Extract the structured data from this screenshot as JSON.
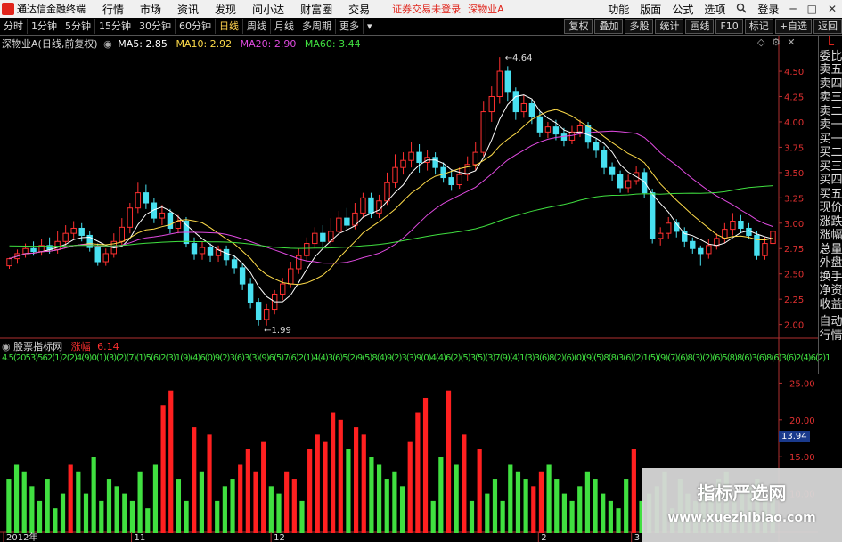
{
  "menubar": {
    "app_name": "通达信金融终端",
    "items": [
      "行情",
      "市场",
      "资讯",
      "发现",
      "问小达",
      "财富圈",
      "交易"
    ],
    "status": "证券交易未登录",
    "stock": "深物业A",
    "right_items": [
      "功能",
      "版面",
      "公式",
      "选项"
    ],
    "search_icon": "search-icon",
    "login": "登录",
    "window_buttons": [
      "─",
      "□",
      "✕"
    ]
  },
  "toolbar": {
    "periods": [
      "分时",
      "1分钟",
      "5分钟",
      "15分钟",
      "30分钟",
      "60分钟",
      "日线",
      "周线",
      "月线",
      "多周期",
      "更多"
    ],
    "active_period": "日线",
    "right_buttons": [
      "复权",
      "叠加",
      "多股",
      "统计",
      "画线",
      "F10",
      "标记",
      "+自选",
      "返回"
    ]
  },
  "main_chart": {
    "stock_label": "深物业A(日线,前复权)",
    "ma5": "MA5: 2.85",
    "ma10": "MA10: 2.92",
    "ma20": "MA20: 2.90",
    "ma60": "MA60: 3.44",
    "high_label": "4.64",
    "low_label": "1.99",
    "colors": {
      "up": "#ff3030",
      "down": "#48e0f0",
      "ma5": "#ffffff",
      "ma10": "#ffdc4a",
      "ma20": "#e04ae0",
      "ma60": "#40e040"
    }
  },
  "right_panel": [
    "L",
    "委比",
    "卖五",
    "卖四",
    "卖三",
    "卖二",
    "卖一",
    "买一",
    "买二",
    "买三",
    "买四",
    "买五",
    "现价",
    "涨跌",
    "涨幅",
    "总量",
    "外盘",
    "换手",
    "净资",
    "收益",
    "自动",
    "行情"
  ],
  "indicator": {
    "name": "股票指标网",
    "param_label": "涨幅",
    "param_value": "6.14",
    "value_strip": "4.5(2053)562(1)2(2)4(9)0(1)(3)(2)(7)(1)5(6)2(3)1(9)(4)6(0)9(2)3(6)3(3)(9)6(5)7(6)2(1)4(4)3(6)5(2)9(5)8(4)9(2)3(3)9(0)4(4)6(2)(5)3(5)(3)7(9)(4)1(3)3(6)8(2)(6)(0)(9)(5)8(8)3(6)(2)1(5)(9)(7)(6)8(3)(2)(6)5(8)8(6)3(6)8(6)3(6)2(4)6(2)1"
  },
  "badge": "13.94",
  "watermark": {
    "title": "指标严选网",
    "url": "www.xuezhibiao.com"
  },
  "chart_data": [
    {
      "type": "candlestick",
      "title": "深物业A(日线,前复权)",
      "y_ticks": [
        "4.50",
        "4.25",
        "4.00",
        "3.75",
        "3.50",
        "3.25",
        "3.00",
        "2.75",
        "2.50",
        "2.25",
        "2.00"
      ],
      "ylim": [
        1.9,
        4.72
      ],
      "annotations": [
        {
          "text": "4.64",
          "value": 4.64
        },
        {
          "text": "1.99",
          "value": 1.99
        }
      ],
      "candles": [
        [
          2.58,
          2.65,
          2.55,
          2.66
        ],
        [
          2.65,
          2.7,
          2.6,
          2.74
        ],
        [
          2.7,
          2.75,
          2.66,
          2.8
        ],
        [
          2.75,
          2.72,
          2.68,
          2.82
        ],
        [
          2.72,
          2.78,
          2.68,
          2.84
        ],
        [
          2.78,
          2.74,
          2.7,
          2.86
        ],
        [
          2.74,
          2.82,
          2.7,
          2.92
        ],
        [
          2.82,
          2.9,
          2.78,
          2.98
        ],
        [
          2.9,
          2.95,
          2.85,
          3.02
        ],
        [
          2.95,
          2.88,
          2.82,
          3.0
        ],
        [
          2.88,
          2.76,
          2.72,
          2.92
        ],
        [
          2.76,
          2.62,
          2.58,
          2.8
        ],
        [
          2.62,
          2.7,
          2.58,
          2.75
        ],
        [
          2.7,
          2.82,
          2.66,
          2.9
        ],
        [
          2.82,
          2.96,
          2.78,
          3.05
        ],
        [
          2.96,
          3.15,
          2.9,
          3.2
        ],
        [
          3.15,
          3.3,
          3.1,
          3.4
        ],
        [
          3.3,
          3.2,
          3.14,
          3.38
        ],
        [
          3.2,
          3.05,
          3.0,
          3.25
        ],
        [
          3.05,
          3.1,
          2.98,
          3.18
        ],
        [
          3.1,
          2.95,
          2.9,
          3.14
        ],
        [
          2.95,
          3.02,
          2.9,
          3.08
        ],
        [
          3.02,
          2.8,
          2.76,
          3.06
        ],
        [
          2.8,
          2.7,
          2.64,
          2.86
        ],
        [
          2.7,
          2.76,
          2.64,
          2.82
        ],
        [
          2.76,
          2.68,
          2.62,
          2.8
        ],
        [
          2.68,
          2.74,
          2.62,
          2.78
        ],
        [
          2.74,
          2.64,
          2.58,
          2.78
        ],
        [
          2.64,
          2.56,
          2.5,
          2.68
        ],
        [
          2.56,
          2.4,
          2.34,
          2.6
        ],
        [
          2.4,
          2.22,
          2.16,
          2.46
        ],
        [
          2.22,
          2.05,
          1.99,
          2.26
        ],
        [
          2.05,
          2.15,
          1.99,
          2.2
        ],
        [
          2.15,
          2.3,
          2.1,
          2.34
        ],
        [
          2.3,
          2.4,
          2.24,
          2.46
        ],
        [
          2.4,
          2.55,
          2.36,
          2.62
        ],
        [
          2.55,
          2.68,
          2.5,
          2.75
        ],
        [
          2.68,
          2.8,
          2.62,
          2.86
        ],
        [
          2.8,
          2.9,
          2.75,
          2.96
        ],
        [
          2.9,
          2.82,
          2.74,
          2.98
        ],
        [
          2.82,
          2.92,
          2.78,
          3.05
        ],
        [
          2.92,
          3.05,
          2.88,
          3.12
        ],
        [
          3.05,
          2.98,
          2.92,
          3.15
        ],
        [
          2.98,
          3.1,
          2.94,
          3.2
        ],
        [
          3.1,
          3.25,
          3.05,
          3.3
        ],
        [
          3.25,
          3.1,
          3.05,
          3.3
        ],
        [
          3.1,
          3.22,
          3.05,
          3.28
        ],
        [
          3.22,
          3.4,
          3.18,
          3.5
        ],
        [
          3.4,
          3.55,
          3.35,
          3.68
        ],
        [
          3.55,
          3.62,
          3.48,
          3.7
        ],
        [
          3.62,
          3.7,
          3.55,
          3.8
        ],
        [
          3.7,
          3.6,
          3.5,
          3.78
        ],
        [
          3.6,
          3.65,
          3.52,
          3.72
        ],
        [
          3.65,
          3.55,
          3.48,
          3.7
        ],
        [
          3.55,
          3.45,
          3.4,
          3.6
        ],
        [
          3.45,
          3.38,
          3.32,
          3.52
        ],
        [
          3.38,
          3.48,
          3.34,
          3.55
        ],
        [
          3.48,
          3.58,
          3.42,
          3.66
        ],
        [
          3.58,
          3.7,
          3.52,
          3.8
        ],
        [
          3.7,
          4.1,
          3.66,
          4.2
        ],
        [
          4.1,
          4.25,
          4.0,
          4.35
        ],
        [
          4.25,
          4.5,
          4.18,
          4.64
        ],
        [
          4.5,
          4.3,
          4.2,
          4.55
        ],
        [
          4.3,
          4.1,
          4.02,
          4.34
        ],
        [
          4.1,
          4.18,
          4.04,
          4.26
        ],
        [
          4.18,
          4.05,
          3.98,
          4.22
        ],
        [
          4.05,
          3.9,
          3.85,
          4.1
        ],
        [
          3.9,
          3.95,
          3.84,
          4.0
        ],
        [
          3.95,
          3.88,
          3.82,
          4.02
        ],
        [
          3.88,
          3.82,
          3.76,
          3.94
        ],
        [
          3.82,
          3.9,
          3.78,
          3.96
        ],
        [
          3.9,
          3.96,
          3.85,
          4.02
        ],
        [
          3.96,
          3.8,
          3.74,
          4.0
        ],
        [
          3.8,
          3.72,
          3.65,
          3.84
        ],
        [
          3.72,
          3.55,
          3.48,
          3.76
        ],
        [
          3.55,
          3.48,
          3.42,
          3.6
        ],
        [
          3.48,
          3.35,
          3.3,
          3.52
        ],
        [
          3.35,
          3.42,
          3.3,
          3.48
        ],
        [
          3.42,
          3.5,
          3.38,
          3.56
        ],
        [
          3.5,
          3.3,
          3.25,
          3.54
        ],
        [
          3.3,
          2.85,
          2.8,
          3.34
        ],
        [
          2.85,
          2.9,
          2.78,
          2.96
        ],
        [
          2.9,
          3.0,
          2.85,
          3.06
        ],
        [
          3.0,
          2.92,
          2.86,
          3.04
        ],
        [
          2.92,
          2.82,
          2.76,
          2.96
        ],
        [
          2.82,
          2.75,
          2.7,
          2.86
        ],
        [
          2.75,
          2.7,
          2.58,
          2.78
        ],
        [
          2.7,
          2.78,
          2.65,
          2.84
        ],
        [
          2.78,
          2.85,
          2.74,
          2.9
        ],
        [
          2.85,
          2.94,
          2.8,
          3.0
        ],
        [
          2.94,
          3.02,
          2.88,
          3.1
        ],
        [
          3.02,
          2.95,
          2.9,
          3.08
        ],
        [
          2.95,
          2.88,
          2.84,
          3.0
        ],
        [
          2.88,
          2.68,
          2.64,
          2.92
        ],
        [
          2.68,
          2.8,
          2.64,
          2.86
        ],
        [
          2.8,
          2.92,
          2.76,
          3.05
        ]
      ]
    },
    {
      "type": "bar",
      "title": "股票指标网",
      "y_ticks": [
        "25.00",
        "20.00",
        "15.00",
        "10.00"
      ],
      "ylim": [
        5,
        26.5
      ],
      "x_labels": [
        "2012年",
        "11",
        "12",
        "2",
        "3"
      ],
      "values": [
        12,
        14,
        13,
        11,
        9,
        12,
        8,
        10,
        14,
        13,
        10,
        15,
        9,
        12,
        11,
        10,
        9,
        13,
        8,
        14,
        22,
        24,
        12,
        9,
        19,
        13,
        18,
        9,
        11,
        12,
        14,
        16,
        13,
        17,
        11,
        10,
        13,
        12,
        9,
        16,
        18,
        17,
        21,
        20,
        16,
        19,
        18,
        15,
        14,
        12,
        13,
        11,
        17,
        21,
        23,
        9,
        15,
        24,
        14,
        18,
        9,
        16,
        10,
        12,
        9,
        14,
        13,
        12,
        11,
        13,
        14,
        12,
        10,
        9,
        11,
        13,
        12,
        10,
        9,
        8,
        12,
        16,
        9,
        10,
        11,
        13,
        8,
        12,
        10,
        9,
        11,
        10,
        12,
        13,
        9,
        10,
        11,
        12,
        9,
        10
      ],
      "up_flags": [
        0,
        0,
        0,
        0,
        0,
        0,
        0,
        0,
        1,
        0,
        0,
        0,
        0,
        0,
        0,
        0,
        0,
        0,
        0,
        0,
        1,
        1,
        0,
        0,
        1,
        0,
        1,
        0,
        0,
        0,
        1,
        1,
        1,
        1,
        0,
        0,
        1,
        1,
        0,
        1,
        1,
        1,
        1,
        1,
        0,
        1,
        1,
        0,
        0,
        0,
        0,
        0,
        1,
        1,
        1,
        0,
        0,
        1,
        0,
        1,
        0,
        1,
        0,
        0,
        0,
        0,
        0,
        0,
        1,
        1,
        0,
        0,
        0,
        0,
        0,
        0,
        0,
        0,
        0,
        0,
        0,
        1,
        0,
        0,
        0,
        0,
        0,
        0,
        0,
        0,
        0,
        0,
        0,
        0,
        0,
        0,
        0,
        0,
        0,
        0
      ]
    }
  ]
}
